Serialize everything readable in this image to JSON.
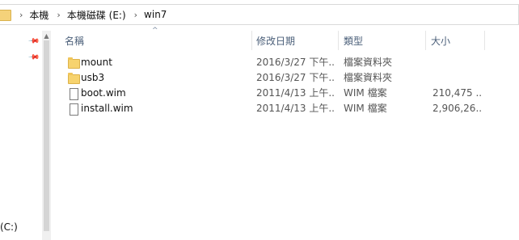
{
  "address": {
    "crumbs": [
      "本機",
      "本機磁碟 (E:)",
      "win7"
    ]
  },
  "nav": {
    "drive_label": "(C:)"
  },
  "columns": {
    "name": "名稱",
    "date": "修改日期",
    "type": "類型",
    "size": "大小"
  },
  "files": [
    {
      "name": "mount",
      "date": "2016/3/27 下午...",
      "type": "檔案資料夾",
      "size": "",
      "icon": "folder-icon"
    },
    {
      "name": "usb3",
      "date": "2016/3/27 下午...",
      "type": "檔案資料夾",
      "size": "",
      "icon": "folder-icon"
    },
    {
      "name": "boot.wim",
      "date": "2011/4/13 上午...",
      "type": "WIM 檔案",
      "size": "210,475 ...",
      "icon": "file-icon"
    },
    {
      "name": "install.wim",
      "date": "2011/4/13 上午...",
      "type": "WIM 檔案",
      "size": "2,906,26...",
      "icon": "file-icon"
    }
  ]
}
